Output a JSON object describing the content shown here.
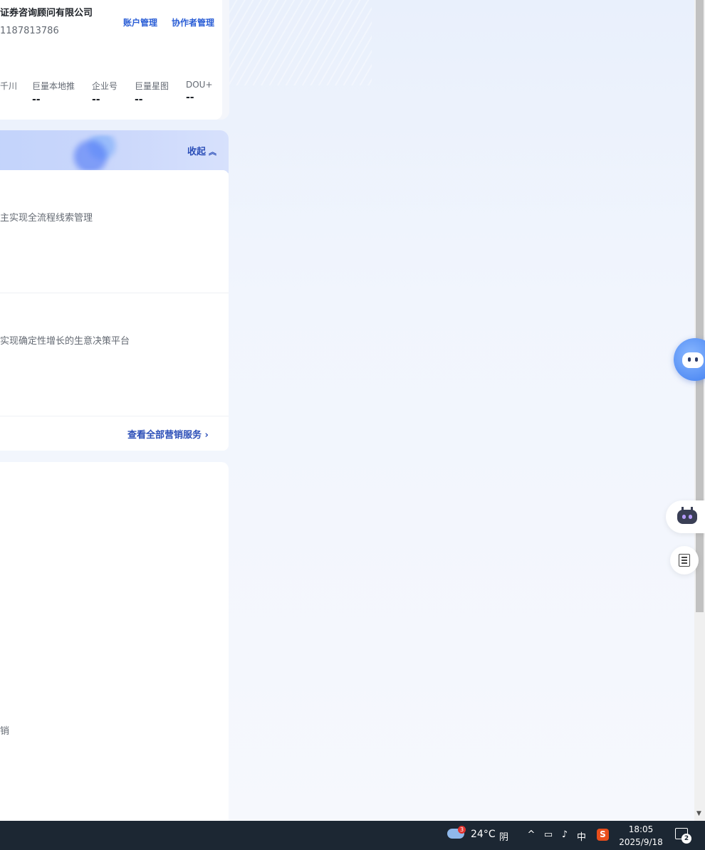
{
  "account": {
    "company": "证券咨询顾问有限公司",
    "id": "1187813786",
    "account_manage": "账户管理",
    "collaborator_manage": "协作者管理",
    "platforms": [
      {
        "name": "千川",
        "value": ""
      },
      {
        "name": "巨量本地推",
        "value": "--"
      },
      {
        "name": "企业号",
        "value": "--"
      },
      {
        "name": "巨量星图",
        "value": "--"
      },
      {
        "name": "DOU+",
        "value": "--"
      }
    ]
  },
  "banner": {
    "collapse_label": "收起",
    "collapse_icon": "double-chevron-up-icon"
  },
  "services": {
    "items": [
      {
        "desc": "主实现全流程线索管理"
      },
      {
        "desc": "实现确定性增长的生意决策平台"
      }
    ],
    "view_all": "查看全部营销服务",
    "view_all_icon": "chevron-right-icon"
  },
  "bottom_card": {
    "partial_text": "销"
  },
  "taskbar": {
    "weather_badge": "3",
    "temperature": "24°C",
    "weather": "阴",
    "ime": "中",
    "ime_app": "S",
    "time": "18:05",
    "date": "2025/9/18",
    "notification_count": "2"
  },
  "colors": {
    "link": "#2c5fd6",
    "banner": "#c3d4fb",
    "taskbar": "#1c2733"
  }
}
